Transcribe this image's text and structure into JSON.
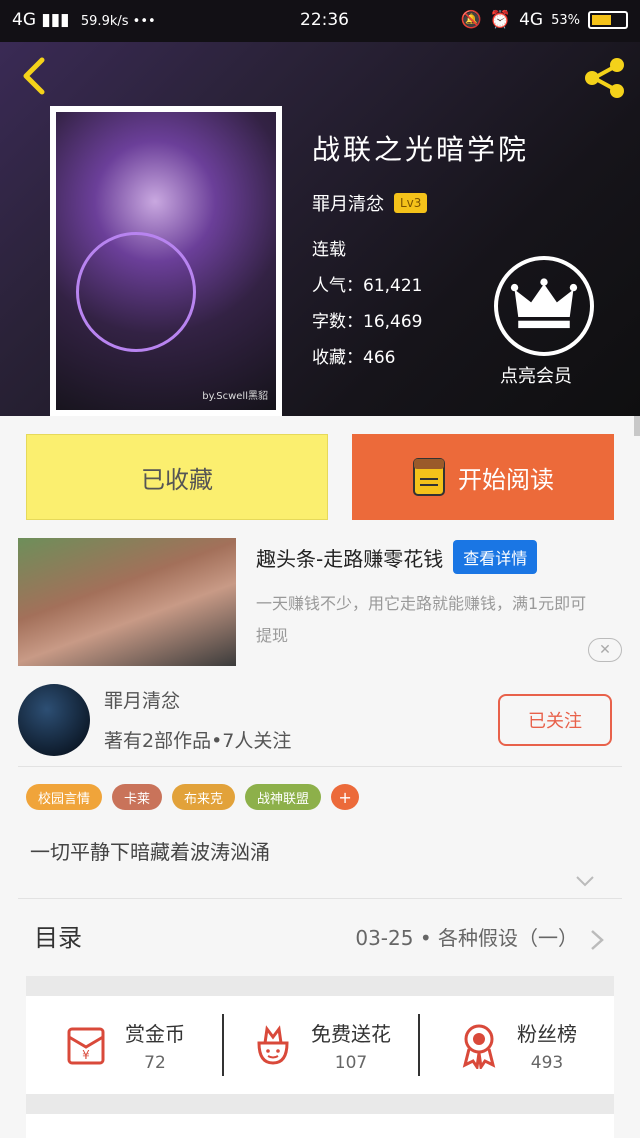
{
  "status_bar": {
    "network": "4G",
    "speed": "59.9k/s •••",
    "time": "22:36",
    "signal2": "4G",
    "battery": "53%",
    "battery_level": 0.53
  },
  "book": {
    "title": "战联之光暗学院",
    "author": "罪月清忿",
    "level": "Lv3",
    "status": "连载",
    "popularity": "人气：61,421",
    "words": "字数：16,469",
    "collections": "收藏：466",
    "cover_caption": "by.Scwell黑貂"
  },
  "vip": {
    "label": "点亮会员"
  },
  "actions": {
    "collect": "已收藏",
    "read": "开始阅读"
  },
  "ad": {
    "headline": "趣头条-走路赚零花钱",
    "detail": "查看详情",
    "desc": "一天赚钱不少，用它走路就能赚钱，满1元即可提现",
    "close": "✕"
  },
  "author_card": {
    "name": "罪月清忿",
    "works": "著有2部作品•7人关注",
    "follow": "已关注"
  },
  "tags": [
    {
      "label": "校园言情",
      "color": "#f0a43a"
    },
    {
      "label": "卡莱",
      "color": "#c9735a"
    },
    {
      "label": "布来克",
      "color": "#e2a23a"
    },
    {
      "label": "战神联盟",
      "color": "#8db04a"
    },
    {
      "label": "+",
      "color": "#ec6a3a"
    }
  ],
  "intro": "一切平静下暗藏着波涛汹涌",
  "toc": {
    "label": "目录",
    "latest": "03-25 • 各种假设（一）"
  },
  "stats": [
    {
      "label": "赏金币",
      "value": "72"
    },
    {
      "label": "免费送花",
      "value": "107"
    },
    {
      "label": "粉丝榜",
      "value": "493"
    }
  ],
  "colors": {
    "accent": "#ec6a3a",
    "collect_bg": "#fbef6f",
    "link_blue": "#1a76e4",
    "icon_red": "#d9493a"
  }
}
